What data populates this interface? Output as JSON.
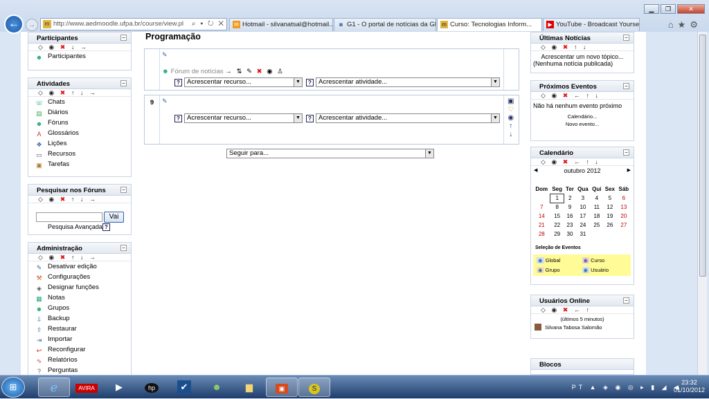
{
  "browser": {
    "address": "http://www.aedmoodle.ufpa.br/course/view.pl",
    "tabs": [
      {
        "label": "Hotmail - silvanatsal@hotmail...",
        "icon": "hotmail-icon"
      },
      {
        "label": "G1 - O portal de notícias da Gl...",
        "icon": "g1-icon"
      },
      {
        "label": "Curso: Tecnologias Inform...",
        "icon": "moodle-icon",
        "active": true
      },
      {
        "label": "YouTube - Broadcast Yourself.",
        "icon": "youtube-icon"
      }
    ]
  },
  "left": {
    "participantes": {
      "title": "Participantes",
      "items": [
        "Participantes"
      ]
    },
    "atividades": {
      "title": "Atividades",
      "items": [
        "Chats",
        "Diários",
        "Fóruns",
        "Glossários",
        "Lições",
        "Recursos",
        "Tarefas"
      ]
    },
    "pesquisar": {
      "title": "Pesquisar nos Fóruns",
      "button": "Vai",
      "link": "Pesquisa Avançada"
    },
    "admin": {
      "title": "Administração",
      "items": [
        "Desativar edição",
        "Configurações",
        "Designar funções",
        "Notas",
        "Grupos",
        "Backup",
        "Restaurar",
        "Importar",
        "Reconfigurar",
        "Relatórios",
        "Perguntas"
      ]
    }
  },
  "main": {
    "title": "Programação",
    "forum_link": "Fórum de notícias",
    "section_number": "9",
    "add_resource": "Acrescentar recurso...",
    "add_activity": "Acrescentar atividade...",
    "jump": "Seguir para..."
  },
  "right": {
    "news": {
      "title": "Últimas Notícias",
      "add": "Acrescentar um novo tópico...",
      "none": "(Nenhuma notícia publicada)"
    },
    "events": {
      "title": "Próximos Eventos",
      "none": "Não há nenhum evento próximo",
      "calendar": "Calendário...",
      "new": "Novo evento..."
    },
    "calendar": {
      "title": "Calendário",
      "month": "outubro 2012",
      "days": [
        "Dom",
        "Seg",
        "Ter",
        "Qua",
        "Qui",
        "Sex",
        "Sáb"
      ],
      "weeks": [
        [
          "",
          "1",
          "2",
          "3",
          "4",
          "5",
          "6"
        ],
        [
          "7",
          "8",
          "9",
          "10",
          "11",
          "12",
          "13"
        ],
        [
          "14",
          "15",
          "16",
          "17",
          "18",
          "19",
          "20"
        ],
        [
          "21",
          "22",
          "23",
          "24",
          "25",
          "26",
          "27"
        ],
        [
          "28",
          "29",
          "30",
          "31",
          "",
          "",
          ""
        ]
      ],
      "selection_title": "Seleção de Eventos",
      "filters": [
        "Global",
        "Curso",
        "Grupo",
        "Usuário"
      ]
    },
    "online": {
      "title": "Usuários Online",
      "period": "(últimos 5 minutos)",
      "user": "Silvana Tabosa Salomão"
    },
    "blocks": {
      "title": "Blocos"
    }
  },
  "taskbar": {
    "lang": "PT",
    "time": "23:32",
    "date": "01/10/2012"
  },
  "colors": {
    "accent": "#1c5aa8",
    "calendar_filter_bg": "#fffb96",
    "weekend": "#c00000"
  }
}
